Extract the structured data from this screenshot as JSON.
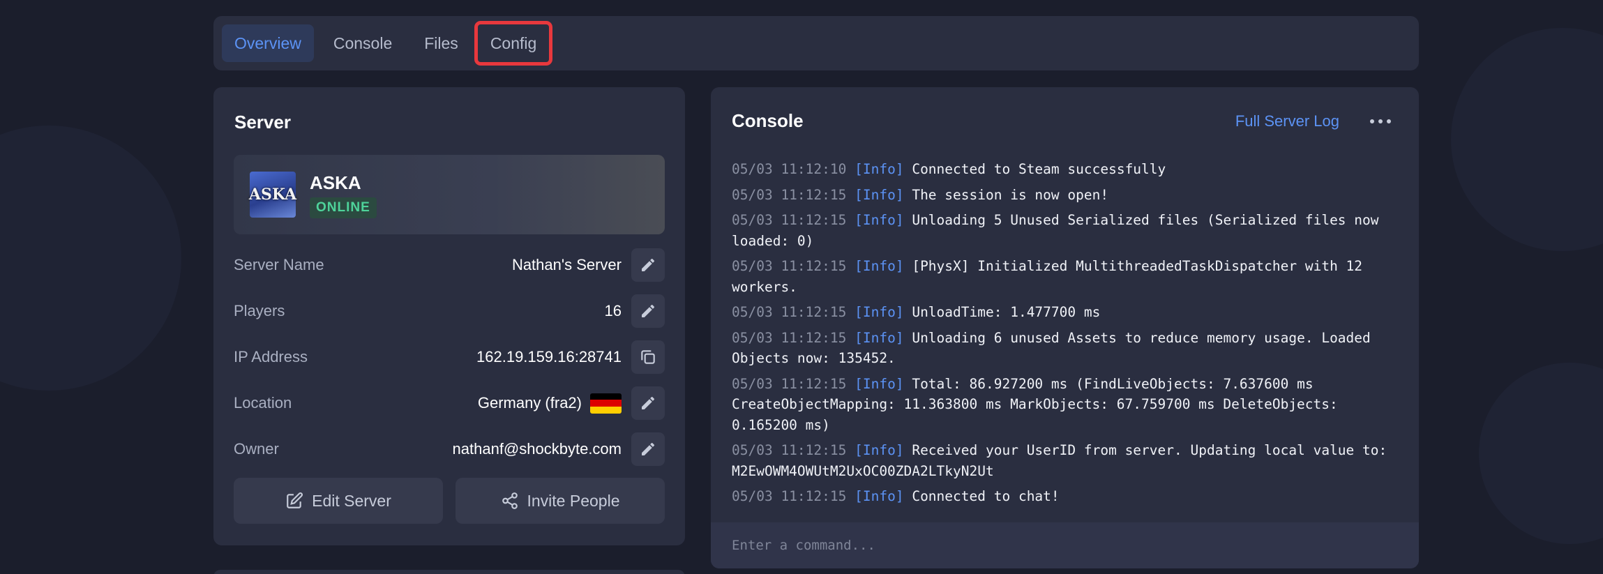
{
  "tabs": [
    {
      "label": "Overview",
      "active": true
    },
    {
      "label": "Console",
      "active": false
    },
    {
      "label": "Files",
      "active": false
    },
    {
      "label": "Config",
      "active": false,
      "highlighted": true
    }
  ],
  "server_card": {
    "title": "Server",
    "game_name": "ASKA",
    "logo_text": "ASKA",
    "status": "ONLINE",
    "rows": [
      {
        "label": "Server Name",
        "value": "Nathan's Server",
        "action_icon": "pencil-icon"
      },
      {
        "label": "Players",
        "value": "16",
        "action_icon": "pencil-icon"
      },
      {
        "label": "IP Address",
        "value": "162.19.159.16:28741",
        "action_icon": "copy-icon"
      },
      {
        "label": "Location",
        "value": "Germany (fra2)",
        "action_icon": "pencil-icon"
      },
      {
        "label": "Owner",
        "value": "nathanf@shockbyte.com",
        "action_icon": "pencil-icon"
      }
    ],
    "edit_button": "Edit Server",
    "invite_button": "Invite People"
  },
  "console": {
    "title": "Console",
    "full_log_link": "Full Server Log",
    "lines": [
      {
        "ts": "05/03 11:12:10",
        "level": "[Info]",
        "msg": "Connected to Steam successfully"
      },
      {
        "ts": "05/03 11:12:15",
        "level": "[Info]",
        "msg": "The session is now open!"
      },
      {
        "ts": "05/03 11:12:15",
        "level": "[Info]",
        "msg": "Unloading 5 Unused Serialized files (Serialized files now loaded: 0)"
      },
      {
        "ts": "05/03 11:12:15",
        "level": "[Info]",
        "msg": "[PhysX] Initialized MultithreadedTaskDispatcher with 12 workers."
      },
      {
        "ts": "05/03 11:12:15",
        "level": "[Info]",
        "msg": "UnloadTime: 1.477700 ms"
      },
      {
        "ts": "05/03 11:12:15",
        "level": "[Info]",
        "msg": "Unloading 6 unused Assets to reduce memory usage. Loaded Objects now: 135452."
      },
      {
        "ts": "05/03 11:12:15",
        "level": "[Info]",
        "msg": "Total: 86.927200 ms (FindLiveObjects: 7.637600 ms CreateObjectMapping: 11.363800 ms MarkObjects: 67.759700 ms DeleteObjects: 0.165200 ms)"
      },
      {
        "ts": "05/03 11:12:15",
        "level": "[Info]",
        "msg": "Received your UserID from server. Updating local value to: M2EwOWM4OWUtM2UxOC00ZDA2LTkyN2Ut"
      },
      {
        "ts": "05/03 11:12:15",
        "level": "[Info]",
        "msg": "Connected to chat!"
      }
    ],
    "command_placeholder": "Enter a command..."
  },
  "colors": {
    "accent": "#5c93f5",
    "online": "#4ed39a",
    "highlight": "#e8383d",
    "flag_black": "#000000",
    "flag_red": "#dd0000",
    "flag_gold": "#ffce00"
  }
}
